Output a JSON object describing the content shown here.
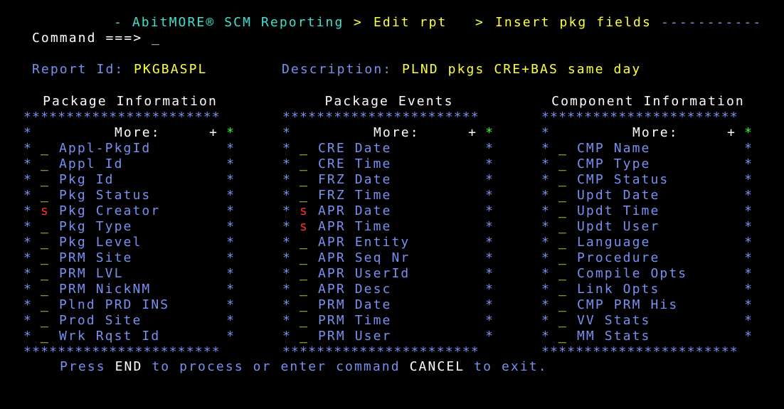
{
  "header": {
    "app": "- AbitMORE® SCM Reporting",
    "sep1": ">",
    "crumb1": "Edit rpt",
    "sep2": ">",
    "crumb2": "Insert pkg fields",
    "dashes": "-----------"
  },
  "command": {
    "label": "Command ===>",
    "value": "_"
  },
  "report": {
    "id_label": "Report Id:",
    "id_value": "PKGBASPL",
    "desc_label": "Description:",
    "desc_value": "PLND pkgs CRE+BAS same day"
  },
  "border_stars": "***********************",
  "more_label": "More:",
  "more_plus": "+",
  "row_marker": "*",
  "panels": [
    {
      "title": "Package Information",
      "items": [
        {
          "sel": "_",
          "label": "Appl-PkgId"
        },
        {
          "sel": "_",
          "label": "Appl Id"
        },
        {
          "sel": "_",
          "label": "Pkg Id"
        },
        {
          "sel": "_",
          "label": "Pkg Status"
        },
        {
          "sel": "s",
          "label": "Pkg Creator"
        },
        {
          "sel": "_",
          "label": "Pkg Type"
        },
        {
          "sel": "_",
          "label": "Pkg Level"
        },
        {
          "sel": "_",
          "label": "PRM Site"
        },
        {
          "sel": "_",
          "label": "PRM LVL"
        },
        {
          "sel": "_",
          "label": "PRM NickNM"
        },
        {
          "sel": "_",
          "label": "Plnd PRD INS"
        },
        {
          "sel": "_",
          "label": "Prod Site"
        },
        {
          "sel": "_",
          "label": "Wrk Rqst Id"
        }
      ]
    },
    {
      "title": "Package Events",
      "items": [
        {
          "sel": "_",
          "label": "CRE Date"
        },
        {
          "sel": "_",
          "label": "CRE Time"
        },
        {
          "sel": "_",
          "label": "FRZ Date"
        },
        {
          "sel": "_",
          "label": "FRZ Time"
        },
        {
          "sel": "s",
          "label": "APR Date"
        },
        {
          "sel": "s",
          "label": "APR Time"
        },
        {
          "sel": "_",
          "label": "APR Entity"
        },
        {
          "sel": "_",
          "label": "APR Seq Nr"
        },
        {
          "sel": "_",
          "label": "APR UserId"
        },
        {
          "sel": "_",
          "label": "APR Desc"
        },
        {
          "sel": "_",
          "label": "PRM Date"
        },
        {
          "sel": "_",
          "label": "PRM Time"
        },
        {
          "sel": "_",
          "label": "PRM User"
        }
      ]
    },
    {
      "title": "Component Information",
      "items": [
        {
          "sel": "_",
          "label": "CMP Name"
        },
        {
          "sel": "_",
          "label": "CMP Type"
        },
        {
          "sel": "_",
          "label": "CMP Status"
        },
        {
          "sel": "_",
          "label": "Updt Date"
        },
        {
          "sel": "_",
          "label": "Updt Time"
        },
        {
          "sel": "_",
          "label": "Updt User"
        },
        {
          "sel": "_",
          "label": "Language"
        },
        {
          "sel": "_",
          "label": "Procedure"
        },
        {
          "sel": "_",
          "label": "Compile Opts"
        },
        {
          "sel": "_",
          "label": "Link Opts"
        },
        {
          "sel": "_",
          "label": "CMP PRM His"
        },
        {
          "sel": "_",
          "label": "VV Stats"
        },
        {
          "sel": "_",
          "label": "MM Stats"
        }
      ]
    }
  ],
  "footer": {
    "part1": "Press",
    "key1": "END",
    "part2": "to process or enter command",
    "key2": "CANCEL",
    "part3": "to exit."
  },
  "colors": {
    "background": "#000000",
    "blue": "#7890f0",
    "yellow": "#ffff40",
    "turquoise": "#40e0d0",
    "red": "#ff3030",
    "green": "#30ff30",
    "white": "#ffffff"
  }
}
